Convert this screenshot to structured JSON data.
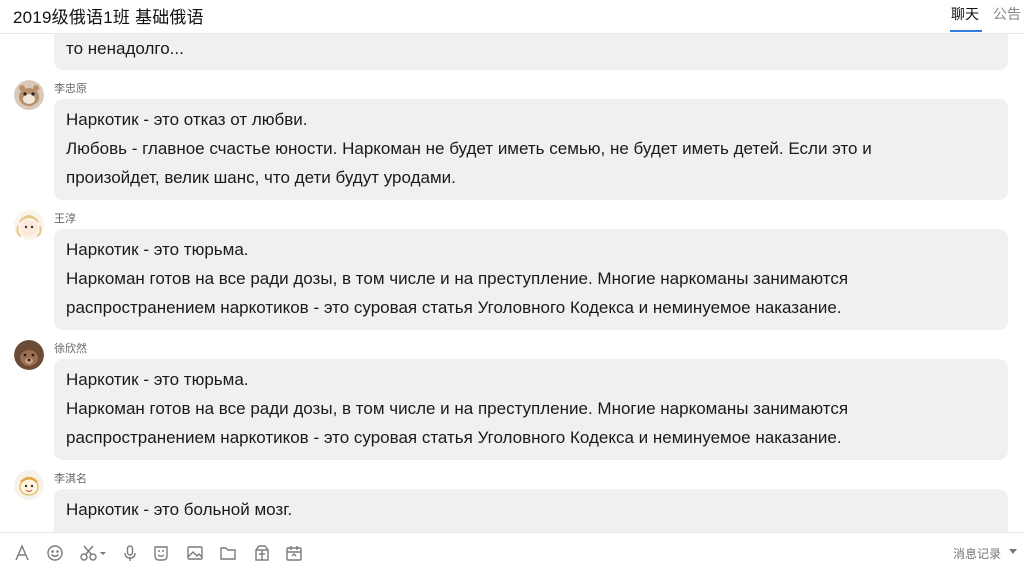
{
  "header": {
    "title": "2019级俄语1班 基础俄语",
    "tabs": [
      {
        "label": "聊天",
        "active": true
      },
      {
        "label": "公告",
        "active": false
      }
    ]
  },
  "messages": [
    {
      "sender": "",
      "lines": [
        "то ненадолго..."
      ]
    },
    {
      "sender": "李忠原",
      "lines": [
        " Наркотик - это отказ от любви.",
        "Любовь - главное счастье юности. Наркоман не будет иметь семью, не будет иметь детей. Если это и",
        "произойдет, велик шанс, что дети будут уродами."
      ]
    },
    {
      "sender": "王淳",
      "lines": [
        "  Наркотик - это тюрьма.",
        "Наркоман готов на все ради дозы, в том числе и на преступление. Многие наркоманы занимаются",
        "распространением наркотиков - это суровая статья Уголовного Кодекса и неминуемое наказание."
      ]
    },
    {
      "sender": "徐欣然",
      "lines": [
        "  Наркотик - это тюрьма.",
        "Наркоман готов на все ради дозы, в том числе и на преступление. Многие наркоманы занимаются",
        "распространением наркотиков - это суровая статья Уголовного Кодекса и неминуемое наказание."
      ]
    },
    {
      "sender": "李淇名",
      "lines": [
        "Наркотик - это больной мозг."
      ]
    }
  ],
  "toolbar": {
    "icons": [
      "font-icon",
      "emoji-icon",
      "screenshot-scissors-icon",
      "voice-icon",
      "sticker-icon",
      "image-icon",
      "folder-icon",
      "gift-icon",
      "calendar-icon"
    ],
    "history_label": "消息记录"
  },
  "colors": {
    "accent": "#2f7fe0",
    "bubble": "#f0f0f0"
  }
}
